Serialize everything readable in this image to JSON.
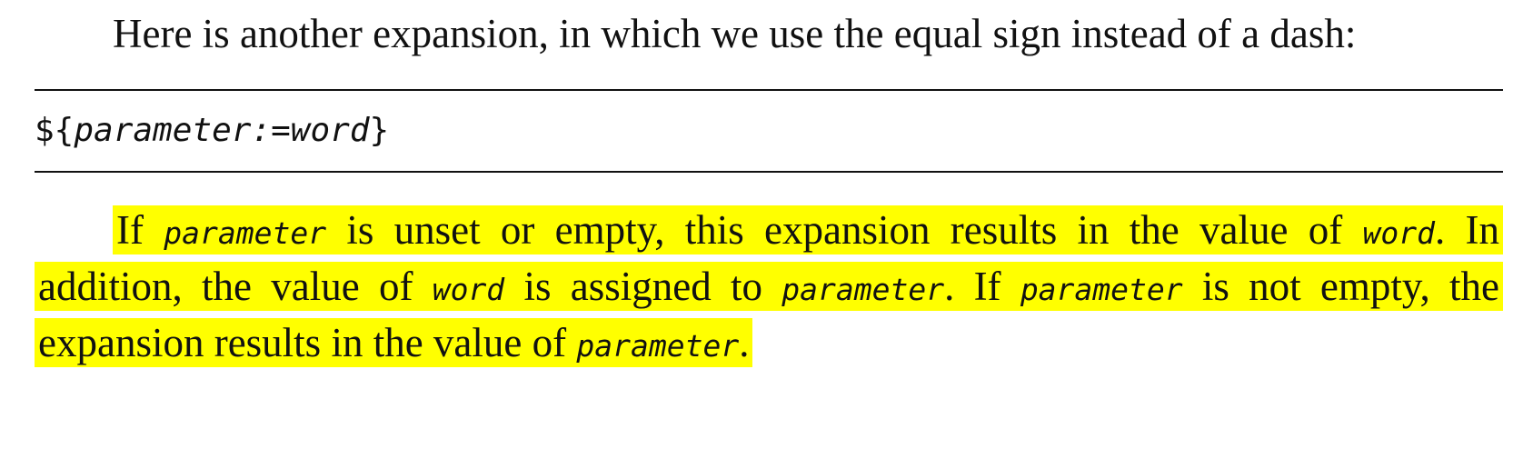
{
  "intro": {
    "text": "Here is another expansion, in which we use the equal sign instead of a dash:"
  },
  "syntax": {
    "prefix": "${",
    "param": "parameter",
    "op": ":=",
    "word": "word",
    "suffix": "}"
  },
  "explanation": {
    "t1": "If ",
    "c1": "parameter",
    "t2": " is unset or empty, this expansion results in the value of ",
    "c2": "word",
    "t3": ". In addition, the value of ",
    "c3": "word",
    "t4": " is assigned to ",
    "c4": "parameter",
    "t5": ". If ",
    "c5": "parameter",
    "t6": " is not empty, the expansion results in the value of ",
    "c6": "parameter",
    "t7": "."
  },
  "highlight_color": "#ffff00"
}
